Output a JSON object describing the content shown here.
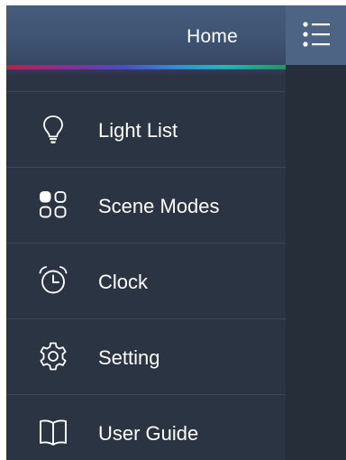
{
  "header": {
    "title": "Home",
    "menu_icon": "list-menu-icon"
  },
  "menu": {
    "items": [
      {
        "label": "Light List",
        "icon": "bulb-icon"
      },
      {
        "label": "Scene Modes",
        "icon": "grid-icon"
      },
      {
        "label": "Clock",
        "icon": "alarm-clock-icon"
      },
      {
        "label": "Setting",
        "icon": "gear-icon"
      },
      {
        "label": "User Guide",
        "icon": "book-icon"
      }
    ]
  },
  "colors": {
    "panel_bg": "#2b3442",
    "header_bg": "#3f5373",
    "menu_button_bg": "#4d6485",
    "text": "#ffffff"
  }
}
